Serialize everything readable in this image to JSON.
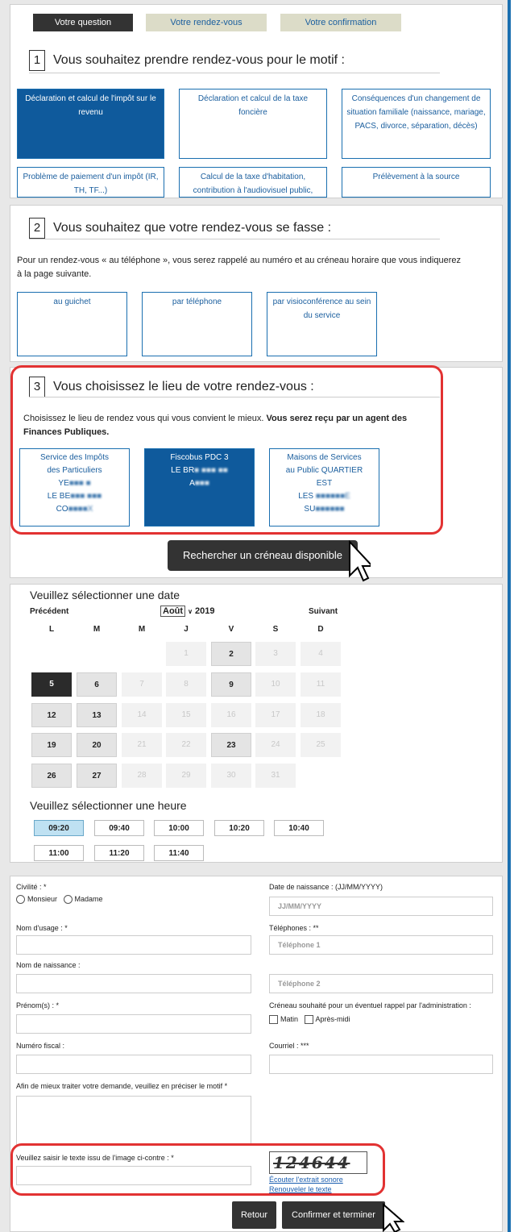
{
  "tabs": [
    "Votre question",
    "Votre rendez-vous",
    "Votre confirmation"
  ],
  "section1": {
    "num": "1",
    "title": "Vous souhaitez prendre rendez-vous pour le motif :",
    "options": [
      "Déclaration et calcul de l'impôt sur le revenu",
      "Déclaration et calcul de la taxe foncière",
      "Conséquences d'un changement de situation familiale (naissance, mariage, PACS, divorce, séparation, décès)",
      "Problème de paiement d'un impôt (IR, TH, TF...)",
      "Calcul de la taxe d'habitation, contribution à l'audiovisuel public,",
      "Prélèvement à la source"
    ]
  },
  "section2": {
    "num": "2",
    "title": "Vous souhaitez que votre rendez-vous se fasse :",
    "intro": "Pour un rendez-vous « au téléphone », vous serez rappelé au numéro et au créneau horaire que vous indiquerez à la page suivante.",
    "options": [
      "au guichet",
      "par téléphone",
      "par visioconférence au sein du service"
    ]
  },
  "section3": {
    "num": "3",
    "title": "Vous choisissez le lieu de votre rendez-vous :",
    "intro": "Choisissez le lieu de rendez vous qui vous convient le mieux.",
    "intro_bold": "Vous serez reçu par un agent des Finances Publiques.",
    "places": [
      {
        "l1": "Service des Impôts",
        "l2": "des Particuliers",
        "l3": "YE",
        "l4": "LE BE",
        "l5": "CO"
      },
      {
        "l1": "Fiscobus PDC 3",
        "l2": "LE BR",
        "l3": "A"
      },
      {
        "l1": "Maisons de Services",
        "l2": "au Public QUARTIER",
        "l3": "EST",
        "l4": "LES",
        "l5": "SU"
      }
    ],
    "search_button": "Rechercher un créneau disponible"
  },
  "calendar": {
    "title": "Veuillez sélectionner une date",
    "prev": "Précédent",
    "month": "Août",
    "year": "2019",
    "next": "Suivant",
    "days": [
      "L",
      "M",
      "M",
      "J",
      "V",
      "S",
      "D"
    ],
    "rows": [
      [
        "",
        "",
        "",
        "1",
        "2",
        "3",
        "4"
      ],
      [
        "5",
        "6",
        "7",
        "8",
        "9",
        "10",
        "11"
      ],
      [
        "12",
        "13",
        "14",
        "15",
        "16",
        "17",
        "18"
      ],
      [
        "19",
        "20",
        "21",
        "22",
        "23",
        "24",
        "25"
      ],
      [
        "26",
        "27",
        "28",
        "29",
        "30",
        "31",
        ""
      ]
    ],
    "available": [
      "2",
      "6",
      "9",
      "12",
      "13",
      "19",
      "20",
      "23",
      "26",
      "27"
    ],
    "selected": "5",
    "time_title": "Veuillez sélectionner une heure",
    "times": [
      "09:20",
      "09:40",
      "10:00",
      "10:20",
      "10:40",
      "11:00",
      "11:20",
      "11:40"
    ],
    "selected_time": "09:20"
  },
  "form": {
    "civilite": "Civilité : *",
    "monsieur": "Monsieur",
    "madame": "Madame",
    "nom_usage": "Nom d'usage : *",
    "nom_naissance": "Nom de naissance :",
    "prenom": "Prénom(s) : *",
    "numero_fiscal": "Numéro fiscal :",
    "motif": "Afin de mieux traiter votre demande, veuillez en préciser le motif *",
    "date_naissance": "Date de naissance : (JJ/MM/YYYY)",
    "date_placeholder": "JJ/MM/YYYY",
    "telephones": "Téléphones : **",
    "tel1": "Téléphone 1",
    "tel2": "Téléphone 2",
    "creneau": "Créneau souhaité pour un éventuel rappel par l'administration :",
    "matin": "Matin",
    "apres_midi": "Après-midi",
    "courriel": "Courriel : ***",
    "captcha_label": "Veuillez saisir le texte issu de l'image ci-contre : *",
    "captcha_text": "124644",
    "listen": "Écouter l'extrait sonore",
    "renew": "Renouveler le texte",
    "retour": "Retour",
    "confirm": "Confirmer et terminer"
  },
  "colors": {
    "accent": "#0f5a9c",
    "highlight": "#e23232",
    "dark": "#333333"
  }
}
